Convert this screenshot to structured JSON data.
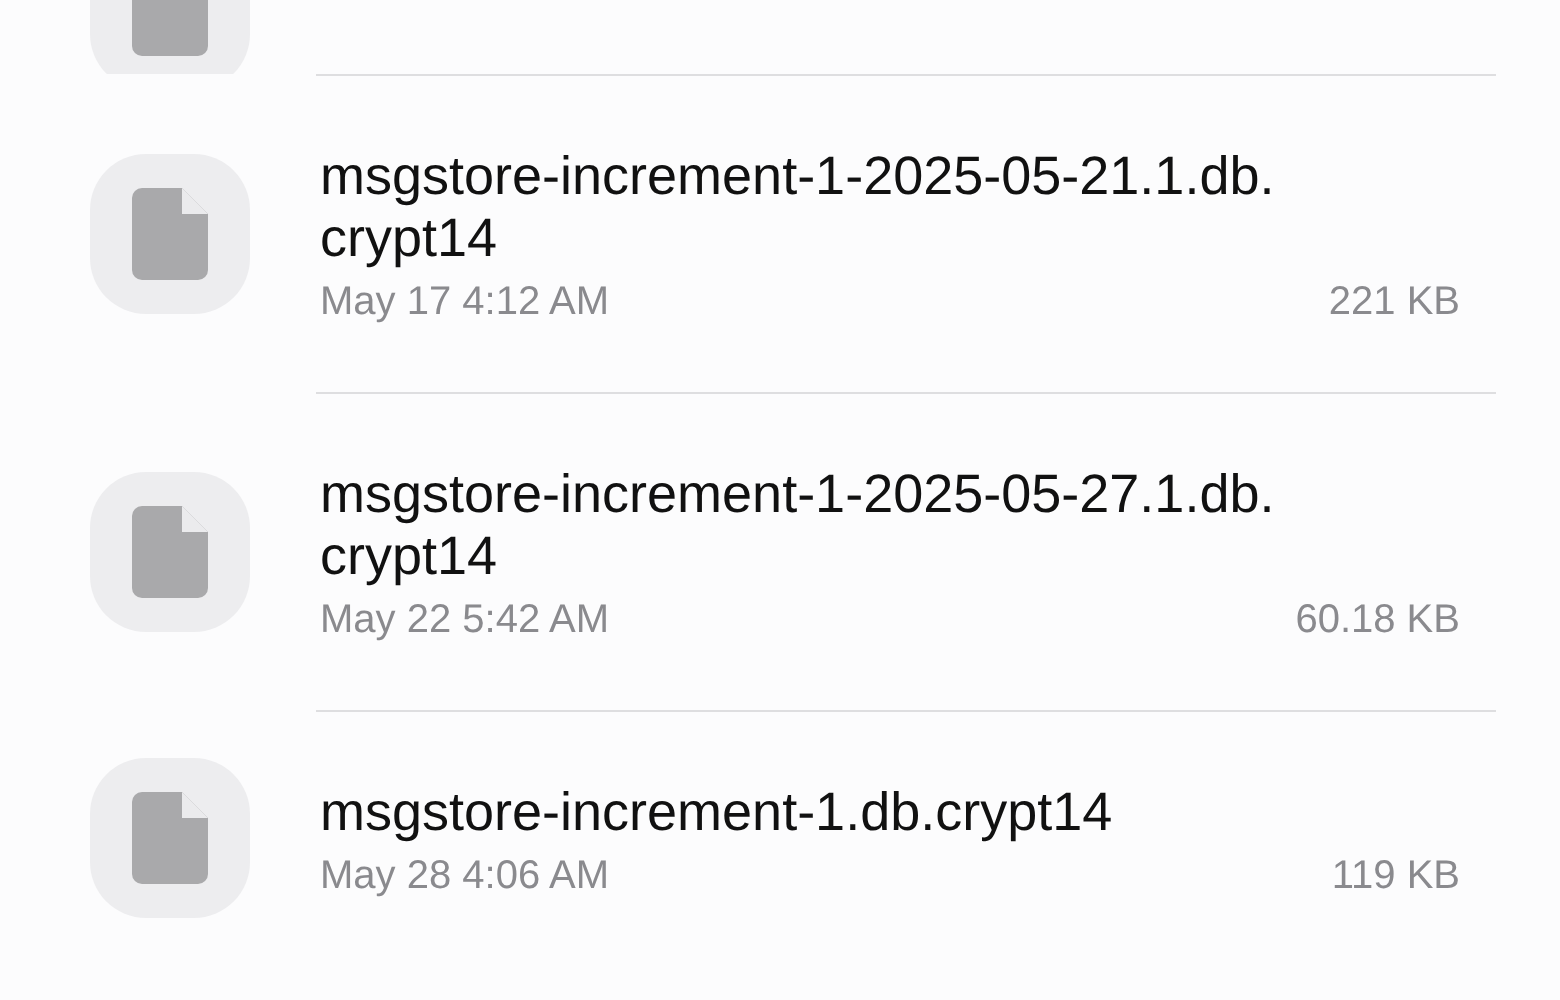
{
  "files": [
    {
      "name": "msgstore-increment-1-2025-05-21.1.db.\ncrypt14",
      "date": "May 17 4:12 AM",
      "size": "221 KB"
    },
    {
      "name": "msgstore-increment-1-2025-05-27.1.db.\ncrypt14",
      "date": "May 22 5:42 AM",
      "size": "60.18 KB"
    },
    {
      "name": "msgstore-increment-1.db.crypt14",
      "date": "May 28 4:06 AM",
      "size": "119 KB"
    }
  ]
}
